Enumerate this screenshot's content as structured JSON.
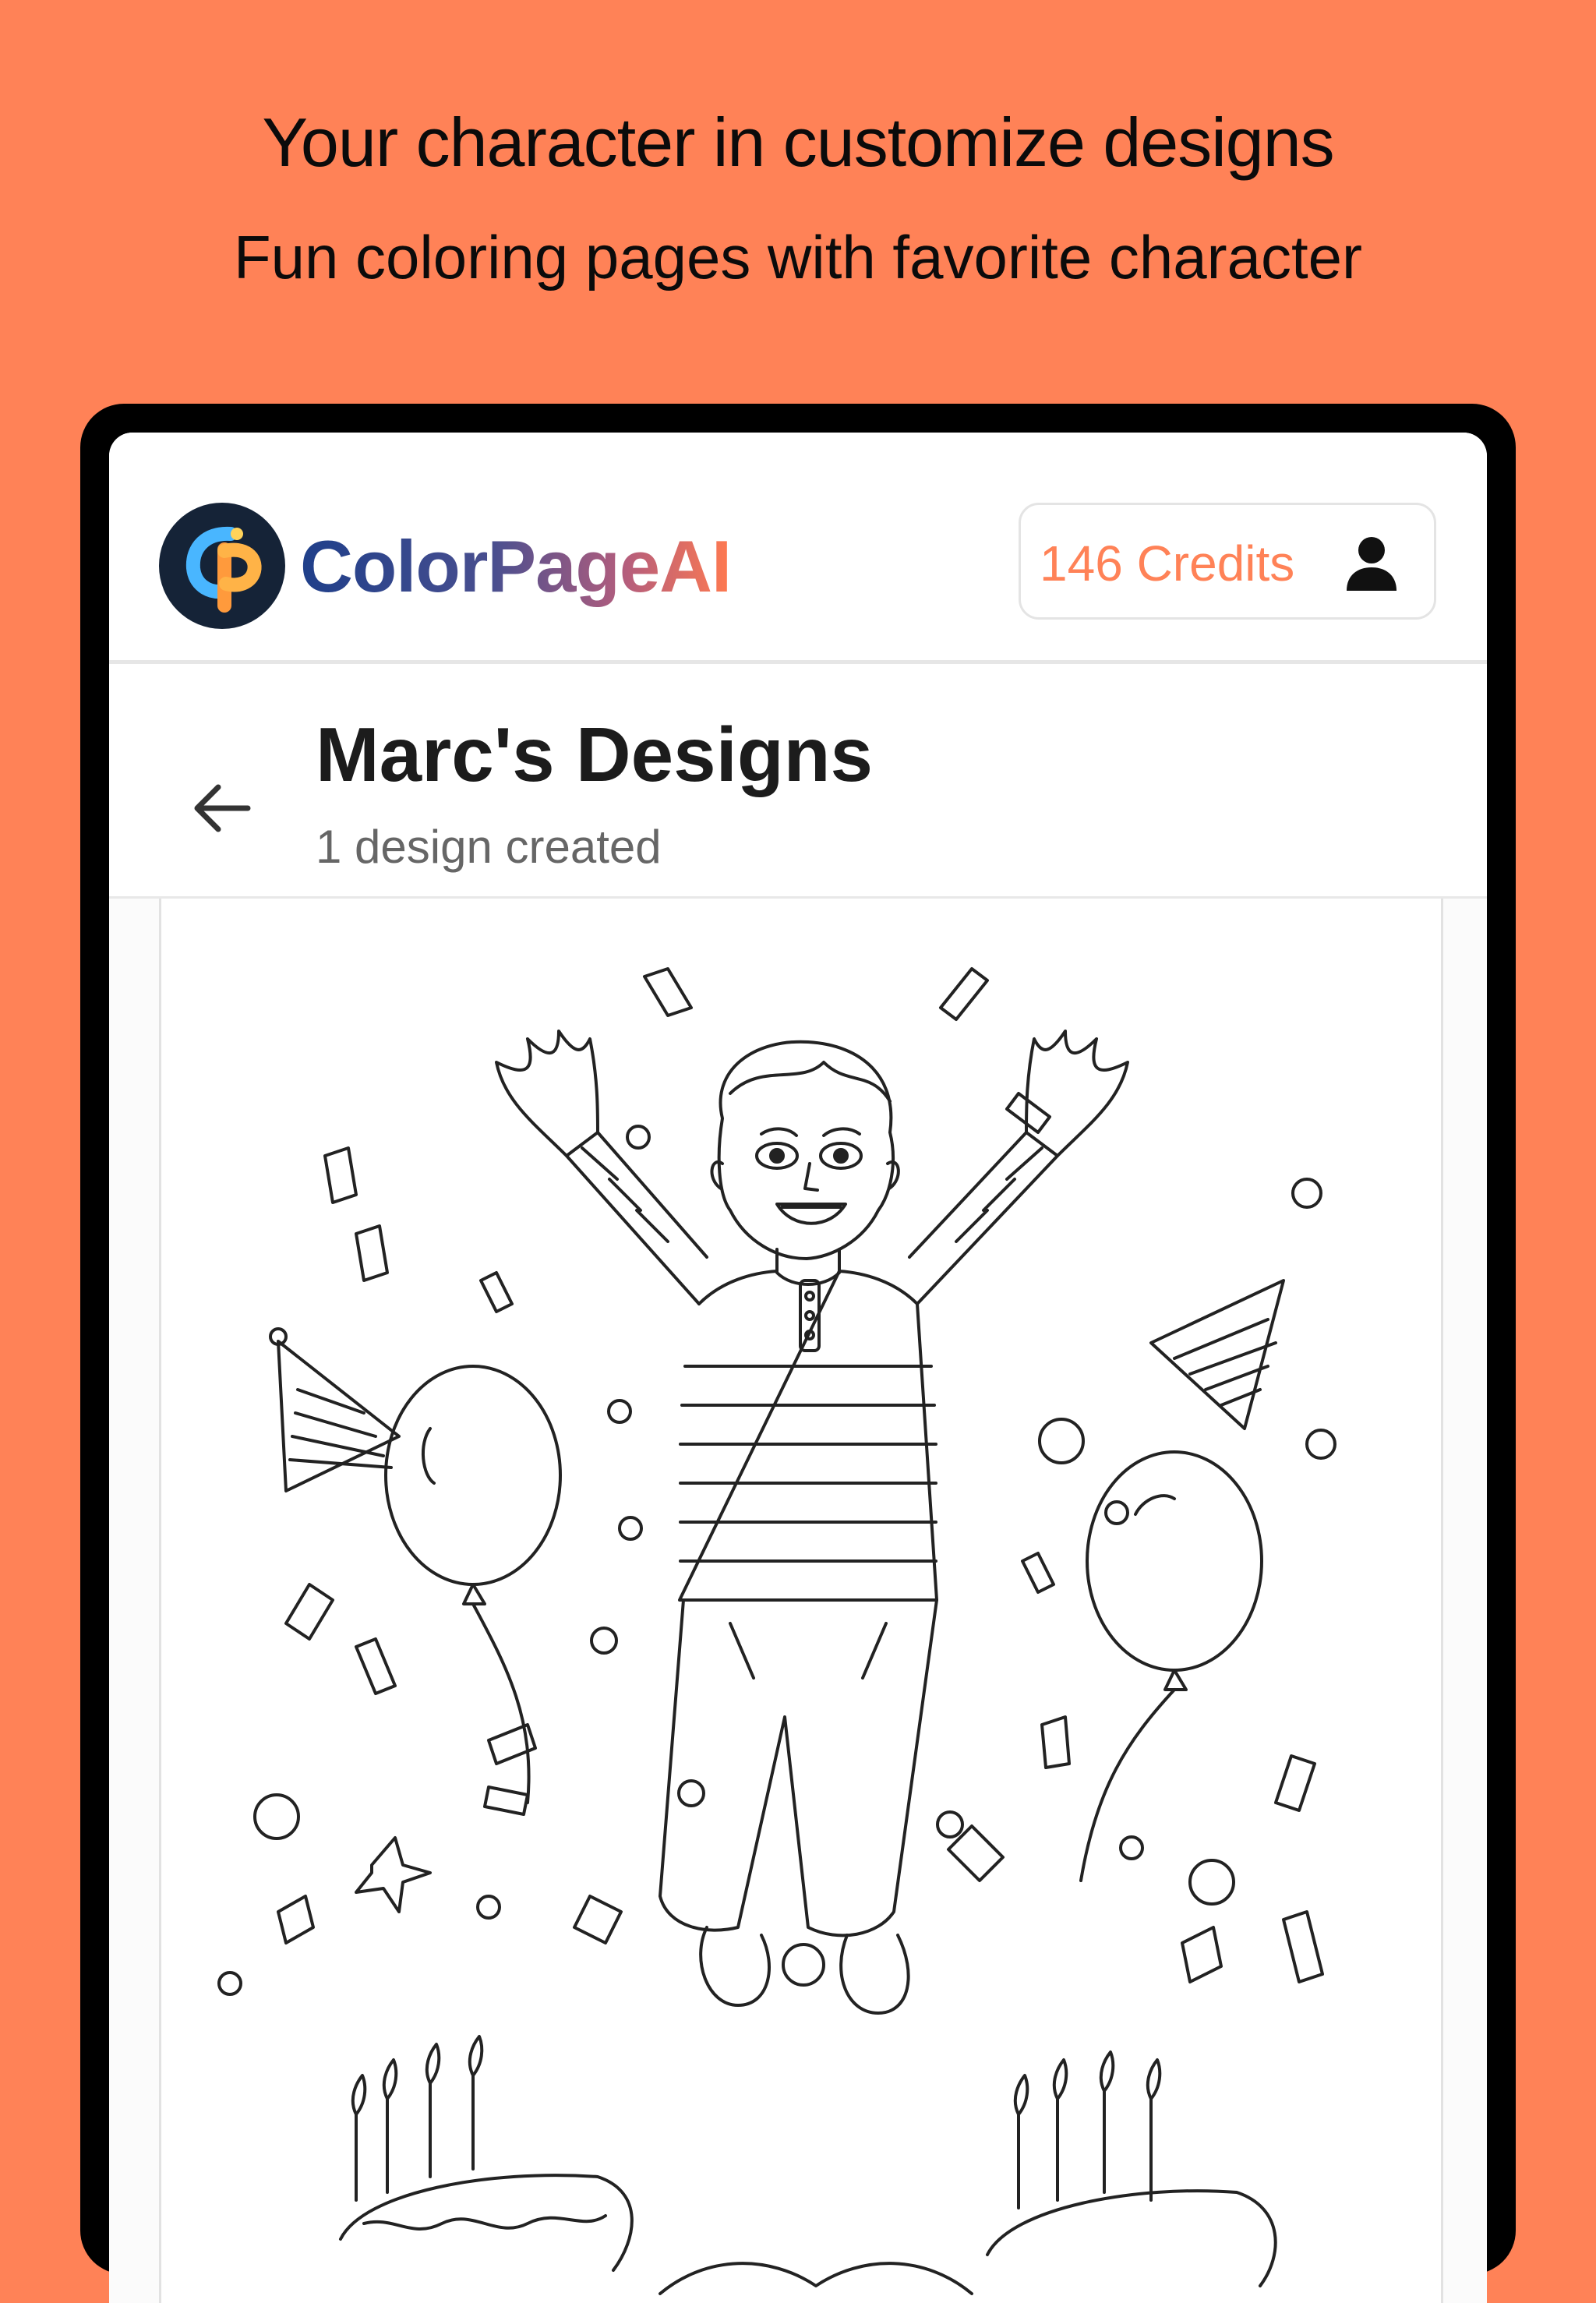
{
  "promo": {
    "title": "Your character in customize designs",
    "subtitle": "Fun coloring pages with favorite character"
  },
  "header": {
    "logo_text": "ColorPageAI",
    "logo_icon": "colorpageai-logo",
    "credits_label": "146 Credits",
    "account_icon": "user-icon"
  },
  "page": {
    "title": "Marc's Designs",
    "subtitle": "1 design created",
    "back_icon": "arrow-left-icon"
  },
  "colors": {
    "background": "#FF8257",
    "accent": "#FF8257",
    "device_frame": "#000000"
  },
  "designs": [
    {
      "image": "coloring-page-boy-jumping-birthday"
    }
  ]
}
